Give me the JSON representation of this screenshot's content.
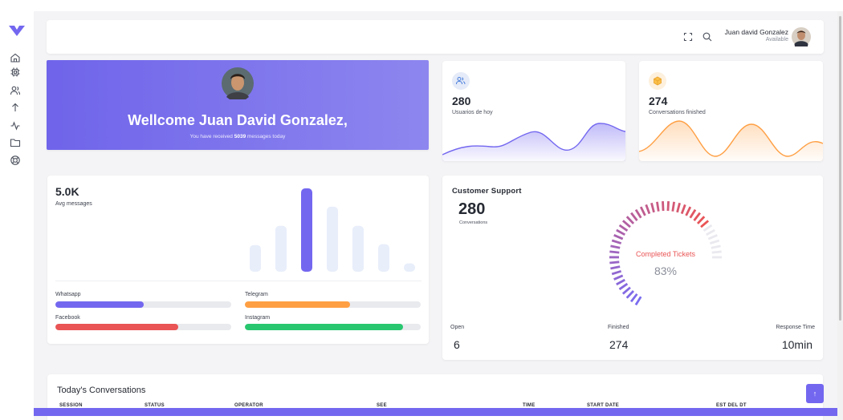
{
  "header": {
    "user_name": "Juan david Gonzalez",
    "user_status": "Available"
  },
  "welcome": {
    "title": "Wellcome Juan David Gonzalez,",
    "sub_prefix": "You have received ",
    "sub_count": "5039",
    "sub_suffix": " messages today"
  },
  "stats": [
    {
      "value": "280",
      "label": "Usuarios de hoy",
      "color": "#7367f0"
    },
    {
      "value": "274",
      "label": "Conversations finished",
      "color": "#ff9f43"
    }
  ],
  "messages": {
    "value": "5.0K",
    "label": "Avg messages",
    "bars": [
      0.32,
      0.55,
      1.0,
      0.78,
      0.55,
      0.33,
      0.1
    ],
    "highlight_index": 2,
    "bar_color": "#7367f0",
    "bar_muted_color": "#e8eefa"
  },
  "channels": [
    {
      "name": "Whatsapp",
      "fraction": 0.5,
      "color": "#7367f0"
    },
    {
      "name": "Telegram",
      "fraction": 0.6,
      "color": "#ff9f43"
    },
    {
      "name": "Facebook",
      "fraction": 0.7,
      "color": "#ea5455"
    },
    {
      "name": "Instagram",
      "fraction": 0.9,
      "color": "#28c76f"
    }
  ],
  "support": {
    "title": "Customer Support",
    "value": "280",
    "sub": "Conversations",
    "gauge_label": "Completed Tickets",
    "gauge_percent": "83%",
    "gauge_fraction": 0.83,
    "columns": [
      {
        "label": "Open",
        "value": "6"
      },
      {
        "label": "Finished",
        "value": "274"
      },
      {
        "label": "Response Time",
        "value": "10min"
      }
    ]
  },
  "conversations": {
    "title": "Today's Conversations",
    "columns": [
      "SESSION",
      "STATUS",
      "OPERATOR",
      "SEE",
      "TIME",
      "START DATE",
      "EST DEL DT"
    ]
  },
  "icons": {
    "logo": "logo-icon",
    "nav": [
      "home-icon",
      "settings-icon",
      "users-icon",
      "arrow-up-icon",
      "activity-icon",
      "folder-icon",
      "lifebuoy-icon"
    ],
    "fullscreen": "fullscreen-icon",
    "search": "search-icon",
    "scroll_top": "arrow-up-icon"
  },
  "colors": {
    "primary": "#7367f0",
    "warning": "#ff9f43",
    "danger": "#ea5455",
    "success": "#28c76f"
  },
  "scroll_top_label": "↑"
}
